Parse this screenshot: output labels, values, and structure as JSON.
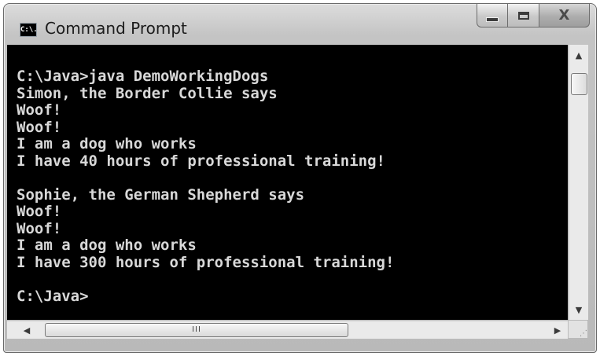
{
  "window": {
    "title": "Command Prompt",
    "icon_text": "C:\\.",
    "buttons": {
      "minimize": "minimize-icon",
      "maximize": "maximize-icon",
      "close_label": "X"
    }
  },
  "console": {
    "lines": [
      "C:\\Java>java DemoWorkingDogs",
      "Simon, the Border Collie says",
      "Woof!",
      "Woof!",
      "I am a dog who works",
      "I have 40 hours of professional training!",
      "",
      "Sophie, the German Shepherd says",
      "Woof!",
      "Woof!",
      "I am a dog who works",
      "I have 300 hours of professional training!",
      "",
      "C:\\Java>"
    ]
  },
  "scrollbars": {
    "horizontal_thumb_grip": "III"
  },
  "colors": {
    "console_bg": "#000000",
    "console_text": "#d8d8d8"
  }
}
